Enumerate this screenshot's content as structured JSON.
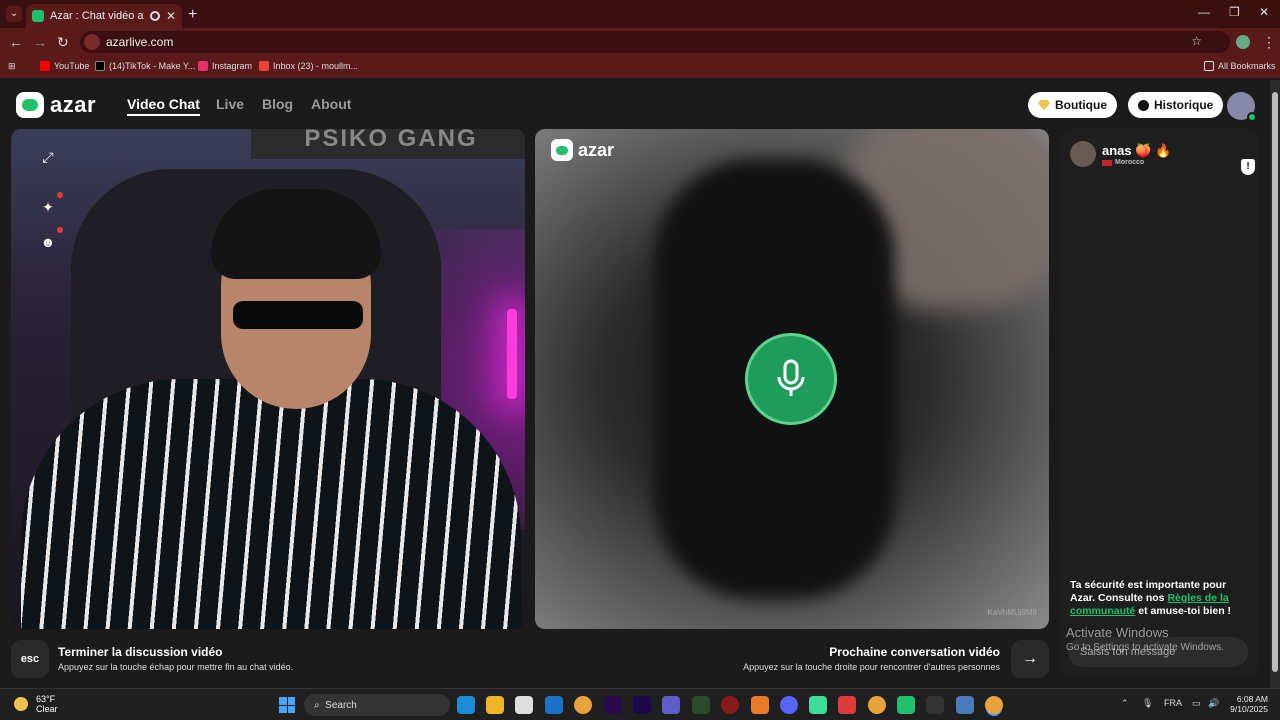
{
  "browser": {
    "tab_title": "Azar : Chat vidéo avec de n",
    "tab_close": "✕",
    "new_tab": "+",
    "url": "azarlive.com",
    "window_controls": [
      "—",
      "❐",
      "✕"
    ],
    "bookmarks": [
      {
        "label": "YouTube",
        "color": "#ff0000"
      },
      {
        "label": "(14)TikTok - Make Y...",
        "color": "#000000"
      },
      {
        "label": "Instagram",
        "color": "#e1306c"
      },
      {
        "label": "Inbox (23) - moullm...",
        "color": "#ea4335"
      }
    ],
    "all_bookmarks": "All Bookmarks"
  },
  "header": {
    "brand": "azar",
    "nav": [
      {
        "label": "Video Chat",
        "active": true
      },
      {
        "label": "Live",
        "active": false
      },
      {
        "label": "Blog",
        "active": false
      },
      {
        "label": "About",
        "active": false
      }
    ],
    "boutique": "Boutique",
    "historique": "Historique"
  },
  "left_video": {
    "banner_text": "PSIKO GANG",
    "side_icons": [
      "expand-icon",
      "sparkle-icon",
      "face-icon"
    ]
  },
  "right_video": {
    "watermark": "azar",
    "code": "KaVhMUj9M8"
  },
  "chat": {
    "partner_name": "anas 🍑 🔥",
    "country": "Morocco",
    "safety_text_1": "Ta sécurité est importante pour Azar. Consulte nos ",
    "safety_link": "Règles de la communauté",
    "safety_text_2": " et amuse-toi bien !",
    "input_placeholder": "Saisis ton message"
  },
  "bottom": {
    "esc_key": "esc",
    "end_title": "Terminer la discussion vidéo",
    "end_sub": "Appuyez sur la touche échap pour mettre fin au chat vidéo.",
    "next_title": "Prochaine conversation vidéo",
    "next_sub": "Appuyez sur la touche droite pour rencontrer d'autres personnes",
    "next_arrow": "→"
  },
  "watermark_windows": {
    "title": "Activate Windows",
    "sub": "Go to Settings to activate Windows."
  },
  "taskbar": {
    "temp": "63°F",
    "condition": "Clear",
    "search": "Search",
    "lang": "FRA",
    "time": "6:08 AM",
    "date": "9/10/2025"
  }
}
